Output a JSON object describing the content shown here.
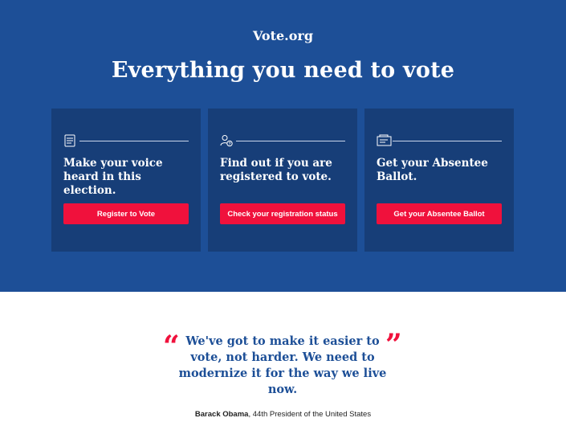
{
  "header": {
    "brand": "Vote.org",
    "headline": "Everything you need to vote"
  },
  "cards": [
    {
      "icon": "checklist-icon",
      "title": "Make your voice heard in this election.",
      "button": "Register to Vote"
    },
    {
      "icon": "person-question-icon",
      "title": "Find out if you are registered to vote.",
      "button": "Check your registration status"
    },
    {
      "icon": "envelope-ballot-icon",
      "title": "Get your Absentee Ballot.",
      "button": "Get your Absentee Ballot"
    }
  ],
  "quote": {
    "text": "We've got to make it easier to vote, not harder. We need to modernize it for the way we live now.",
    "open_mark": "“",
    "close_mark": "”",
    "author": "Barack Obama",
    "author_title": ", 44th President of the United States"
  },
  "colors": {
    "hero": "#1d4f97",
    "card": "#173e78",
    "accent": "#f0113c"
  }
}
